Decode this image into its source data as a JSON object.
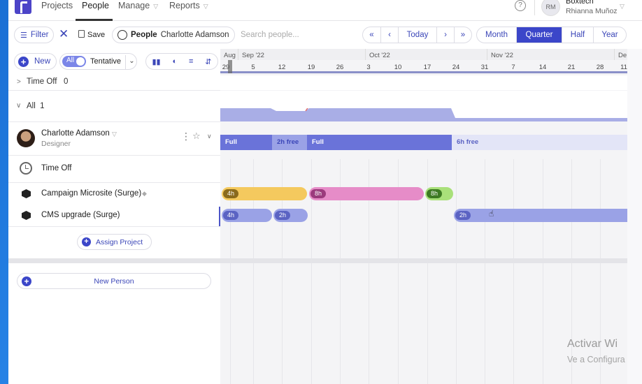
{
  "nav": {
    "items": [
      {
        "label": "Projects"
      },
      {
        "label": "People"
      },
      {
        "label": "Manage"
      },
      {
        "label": "Reports"
      }
    ],
    "help": "?",
    "avatar_initials": "RM",
    "org_name": "Boxtech",
    "user_name": "Rhianna Muñoz"
  },
  "toolbar": {
    "filter_label": "Filter",
    "save_label": "Save",
    "people_label": "People",
    "people_value": "Charlotte Adamson",
    "search_placeholder": "Search people...",
    "today_label": "Today",
    "scales": [
      "Month",
      "Quarter",
      "Half",
      "Year"
    ],
    "selected_scale": "Quarter",
    "new_label": "New",
    "toggle_label": "All",
    "tentative_label": "Tentative"
  },
  "groups": {
    "time_off": {
      "label": "Time Off",
      "count": "0"
    },
    "all": {
      "label": "All",
      "count": "1"
    }
  },
  "person": {
    "name": "Charlotte Adamson",
    "role": "Designer",
    "rows": [
      {
        "label": "Time Off"
      },
      {
        "label": "Campaign Microsite (Surge)"
      },
      {
        "label": "CMS upgrade (Surge)"
      }
    ],
    "assign_label": "Assign Project"
  },
  "new_person_label": "New Person",
  "timeline": {
    "months": [
      {
        "label": "Aug"
      },
      {
        "label": "Sep '22"
      },
      {
        "label": "Oct '22"
      },
      {
        "label": "Nov '22"
      },
      {
        "label": "De"
      }
    ],
    "days": [
      "29",
      "5",
      "12",
      "19",
      "26",
      "3",
      "10",
      "17",
      "24",
      "31",
      "7",
      "14",
      "21",
      "28",
      "11"
    ],
    "capacity": [
      {
        "label": "Full",
        "color": "#6a73d9"
      },
      {
        "label": "2h free",
        "color": "#9aa2e6"
      },
      {
        "label": "Full",
        "color": "#6a73d9"
      },
      {
        "label": "6h free",
        "color": "#e3e5f7"
      }
    ],
    "campaign_allocations": [
      {
        "hours": "4h",
        "color": "#f4c95e",
        "badge": "#8a6a1c"
      },
      {
        "hours": "8h",
        "color": "#e68cc8",
        "badge": "#9b3a7d"
      },
      {
        "hours": "8h",
        "color": "#a9e07a",
        "badge": "#3d7a23"
      }
    ],
    "cms_allocations": [
      {
        "hours": "4h",
        "color": "#9aa2e6",
        "badge": "#5b63c3"
      },
      {
        "hours": "2h",
        "color": "#9aa2e6",
        "badge": "#5b63c3"
      },
      {
        "hours": "2h",
        "color": "#9aa2e6",
        "badge": "#5b63c3"
      }
    ]
  },
  "watermark": {
    "line1": "Activar Wi",
    "line2": "Ve a Configura"
  }
}
